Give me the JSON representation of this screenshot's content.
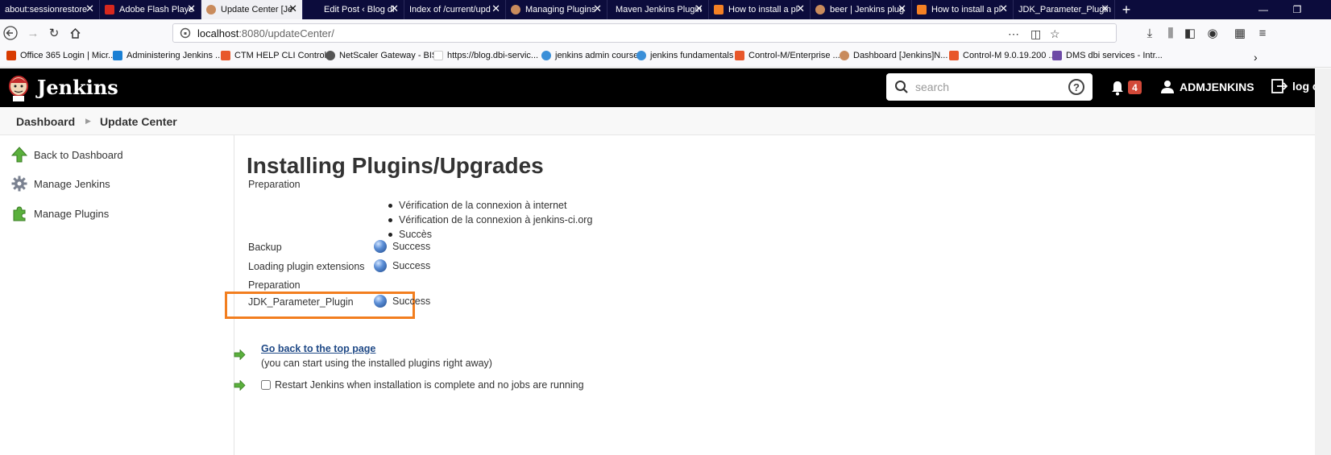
{
  "browser": {
    "tabs": [
      {
        "label": "about:sessionrestore",
        "color": "#8a8ab0"
      },
      {
        "label": "Adobe Flash Playe",
        "color": "#d7281e"
      },
      {
        "label": "Update Center [Je",
        "color": "#c98b5c"
      },
      {
        "label": "Edit Post ‹ Blog dl",
        "color": "#0c0c3c"
      },
      {
        "label": "Index of /current/upd",
        "color": "#0c0c3c"
      },
      {
        "label": "Managing Plugins",
        "color": "#c98b5c"
      },
      {
        "label": "Maven Jenkins Plugin",
        "color": "#0c0c3c"
      },
      {
        "label": "How to install a pl",
        "color": "#f48024"
      },
      {
        "label": "beer | Jenkins plug",
        "color": "#c98b5c"
      },
      {
        "label": "How to install a pl",
        "color": "#f48024"
      },
      {
        "label": "JDK_Parameter_Plugin",
        "color": "#0c0c3c"
      }
    ],
    "url": {
      "host": "localhost",
      "path": ":8080/updateCenter/"
    },
    "bookmarks": [
      {
        "label": "Office 365 Login | Micr...",
        "color": "#d83b01"
      },
      {
        "label": "Administering Jenkins ...",
        "color": "#1a7fd4"
      },
      {
        "label": "CTM HELP CLI Control...",
        "color": "#e8572a"
      },
      {
        "label": "NetScaler Gateway - BIS",
        "color": "#555555"
      },
      {
        "label": "https://blog.dbi-servic...",
        "color": "#ffffff"
      },
      {
        "label": "jenkins admin course",
        "color": "#3a8fd8"
      },
      {
        "label": "jenkins fundamentals",
        "color": "#3a8fd8"
      },
      {
        "label": "Control-M/Enterprise ...",
        "color": "#e8572a"
      },
      {
        "label": "Dashboard [Jenkins]N...",
        "color": "#c98b5c"
      },
      {
        "label": "Control-M 9.0.19.200 ...",
        "color": "#e8572a"
      },
      {
        "label": "DMS dbi services - Intr...",
        "color": "#6d4aa6"
      }
    ]
  },
  "header": {
    "title": "Jenkins",
    "search_placeholder": "search",
    "notifications": "4",
    "user": "ADMJENKINS",
    "logout": "log out"
  },
  "breadcrumb": {
    "items": [
      "Dashboard",
      "Update Center"
    ]
  },
  "sidebar": {
    "items": [
      {
        "label": "Back to Dashboard",
        "icon": "up-arrow-icon"
      },
      {
        "label": "Manage Jenkins",
        "icon": "gear-icon"
      },
      {
        "label": "Manage Plugins",
        "icon": "puzzle-icon"
      }
    ]
  },
  "main": {
    "title": "Installing Plugins/Upgrades",
    "preparation_label": "Preparation",
    "preparation_steps": [
      "Vérification de la connexion à internet",
      "Vérification de la connexion à jenkins-ci.org",
      "Succès"
    ],
    "jobs": [
      {
        "name": "Backup",
        "status": "Success"
      },
      {
        "name": "Loading plugin extensions",
        "status": "Success"
      },
      {
        "name": "Preparation",
        "status": ""
      },
      {
        "name": "JDK_Parameter_Plugin",
        "status": "Success"
      }
    ],
    "back_link": "Go back to the top page",
    "back_note": "(you can start using the installed plugins right away)",
    "restart_label": "Restart Jenkins when installation is complete and no jobs are running",
    "restart_checked": false
  },
  "colors": {
    "accent_highlight": "#f27e1f",
    "header_bg": "#000000",
    "badge": "#d24939",
    "link": "#204a87"
  }
}
